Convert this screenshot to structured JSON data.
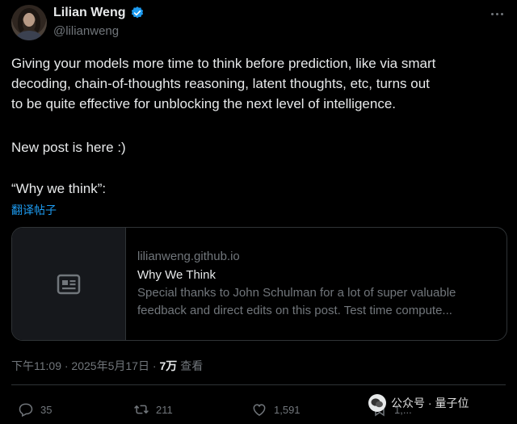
{
  "author": {
    "name": "Lilian Weng",
    "handle": "@lilianweng"
  },
  "post": {
    "lines": [
      "Giving your models more time to think before prediction, like via smart",
      "decoding, chain-of-thoughts reasoning, latent thoughts, etc, turns out",
      "to be quite effective for unblocking the next level of intelligence."
    ],
    "paragraph2": "New post is here :)",
    "paragraph3": "“Why we think”:",
    "translate_label": "翻译帖子"
  },
  "link_card": {
    "domain": "lilianweng.github.io",
    "title": "Why We Think",
    "desc_line1": "Special thanks to John Schulman for a lot of super valuable",
    "desc_line2": "feedback and direct edits on this post. Test time compute..."
  },
  "meta": {
    "time": "下午11:09 · 2025年5月17日 · ",
    "views_count": "7万",
    "views_label": " 查看"
  },
  "actions": {
    "replies": "35",
    "reposts": "211",
    "likes": "1,591",
    "bookmarks": "1,..."
  },
  "watermark": {
    "text": "公众号 · 量子位"
  },
  "colors": {
    "background": "#000000",
    "text": "#e7e9ea",
    "secondary": "#71767b",
    "accent": "#1d9bf0",
    "border": "#2f3336"
  }
}
